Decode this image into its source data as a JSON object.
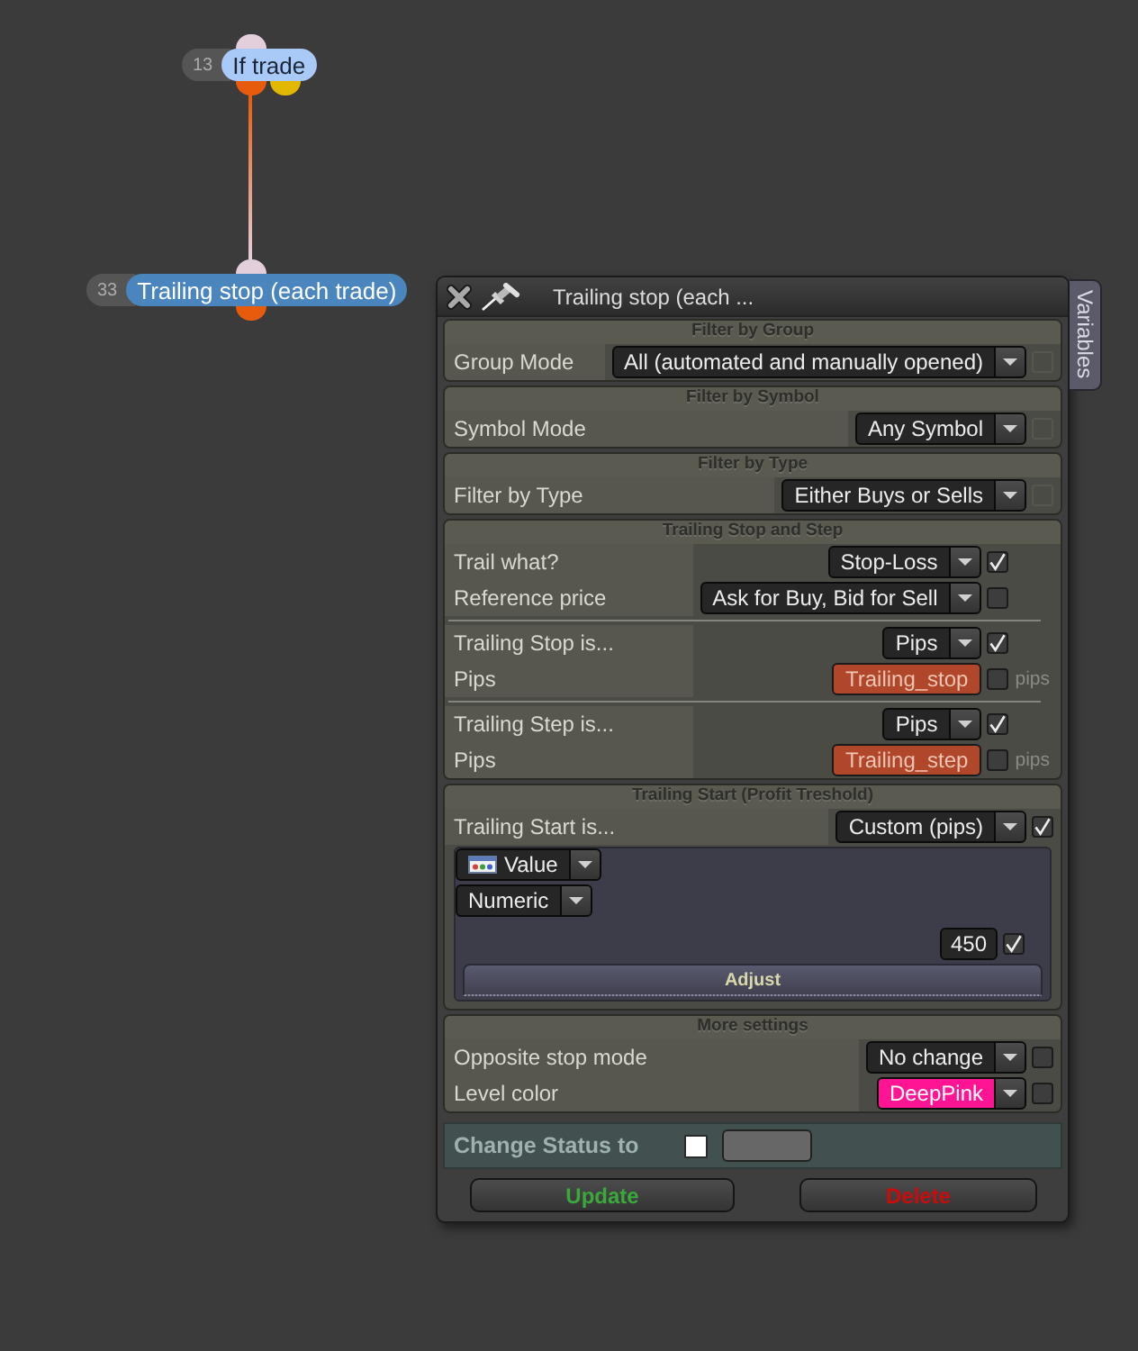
{
  "canvas": {
    "nodes": [
      {
        "number": "13",
        "label": "If trade",
        "color": "#a9c9f7",
        "ports": [
          {
            "kind": "input",
            "color": "#e3cfdc"
          },
          {
            "kind": "output",
            "color": "#e65c0c",
            "connected": true
          },
          {
            "kind": "output",
            "color": "#e2b800",
            "connected": false
          }
        ]
      },
      {
        "number": "33",
        "label": "Trailing stop (each trade)",
        "color": "#4a85bd",
        "ports": [
          {
            "kind": "input",
            "color": "#e3cfdc"
          },
          {
            "kind": "output",
            "color": "#e65c0c"
          }
        ]
      }
    ]
  },
  "window": {
    "title": "Trailing stop (each ...",
    "side_tab": "Variables",
    "sections": [
      {
        "title": "Filter by Group",
        "groups": [
          [
            {
              "label": "Group Mode",
              "control": {
                "kind": "dropdown",
                "value": "All (automated and manually opened)"
              },
              "checkbox": {
                "checked": false,
                "disabled": true
              }
            }
          ]
        ]
      },
      {
        "title": "Filter by Symbol",
        "groups": [
          [
            {
              "label": "Symbol Mode",
              "control": {
                "kind": "dropdown",
                "value": "Any Symbol"
              },
              "checkbox": {
                "checked": false,
                "disabled": true
              }
            }
          ]
        ]
      },
      {
        "title": "Filter by Type",
        "groups": [
          [
            {
              "label": "Filter by Type",
              "control": {
                "kind": "dropdown",
                "value": "Either Buys or Sells"
              },
              "checkbox": {
                "checked": false,
                "disabled": true
              }
            }
          ]
        ]
      },
      {
        "title": "Trailing Stop and Step",
        "groups": [
          [
            {
              "label": "Trail what?",
              "control": {
                "kind": "dropdown",
                "value": "Stop-Loss"
              },
              "checkbox": {
                "checked": true,
                "disabled": false
              }
            },
            {
              "label": "Reference price",
              "control": {
                "kind": "dropdown",
                "value": "Ask for Buy, Bid for Sell"
              },
              "checkbox": {
                "checked": false,
                "disabled": false
              }
            }
          ],
          [
            {
              "label": "Trailing Stop is...",
              "control": {
                "kind": "dropdown",
                "value": "Pips"
              },
              "checkbox": {
                "checked": true,
                "disabled": false
              }
            },
            {
              "label": "Pips",
              "control": {
                "kind": "variable",
                "value": "Trailing_stop"
              },
              "checkbox": {
                "checked": false,
                "disabled": false
              },
              "unit": "pips"
            }
          ],
          [
            {
              "label": "Trailing Step is...",
              "control": {
                "kind": "dropdown",
                "value": "Pips"
              },
              "checkbox": {
                "checked": true,
                "disabled": false
              }
            },
            {
              "label": "Pips",
              "control": {
                "kind": "variable",
                "value": "Trailing_step"
              },
              "checkbox": {
                "checked": false,
                "disabled": false
              },
              "unit": "pips"
            }
          ]
        ]
      },
      {
        "title": "Trailing Start (Profit Treshold)",
        "groups": [
          [
            {
              "label": "Trailing Start is...",
              "control": {
                "kind": "dropdown",
                "value": "Custom (pips)"
              },
              "checkbox": {
                "checked": true,
                "disabled": false
              }
            }
          ]
        ],
        "editor": {
          "source": {
            "kind": "dropdown",
            "value": "Value"
          },
          "type": {
            "kind": "dropdown",
            "value": "Numeric"
          },
          "value": {
            "kind": "number",
            "value": "450"
          },
          "checkbox": {
            "checked": true,
            "disabled": false
          },
          "button": "Adjust"
        }
      },
      {
        "title": "More settings",
        "groups": [
          [
            {
              "label": "Opposite stop mode",
              "control": {
                "kind": "dropdown",
                "value": "No change"
              },
              "checkbox": {
                "checked": false,
                "disabled": false
              }
            },
            {
              "label": "Level color",
              "control": {
                "kind": "dropdown",
                "value": "DeepPink",
                "color": "#ff1493"
              },
              "checkbox": {
                "checked": false,
                "disabled": false
              }
            }
          ]
        ]
      }
    ],
    "status": {
      "label": "Change Status to",
      "checkbox": {
        "checked": false
      }
    },
    "buttons": [
      {
        "label": "Update",
        "color": "#3aa83a"
      },
      {
        "label": "Delete",
        "color": "#cc0c0c"
      }
    ]
  }
}
